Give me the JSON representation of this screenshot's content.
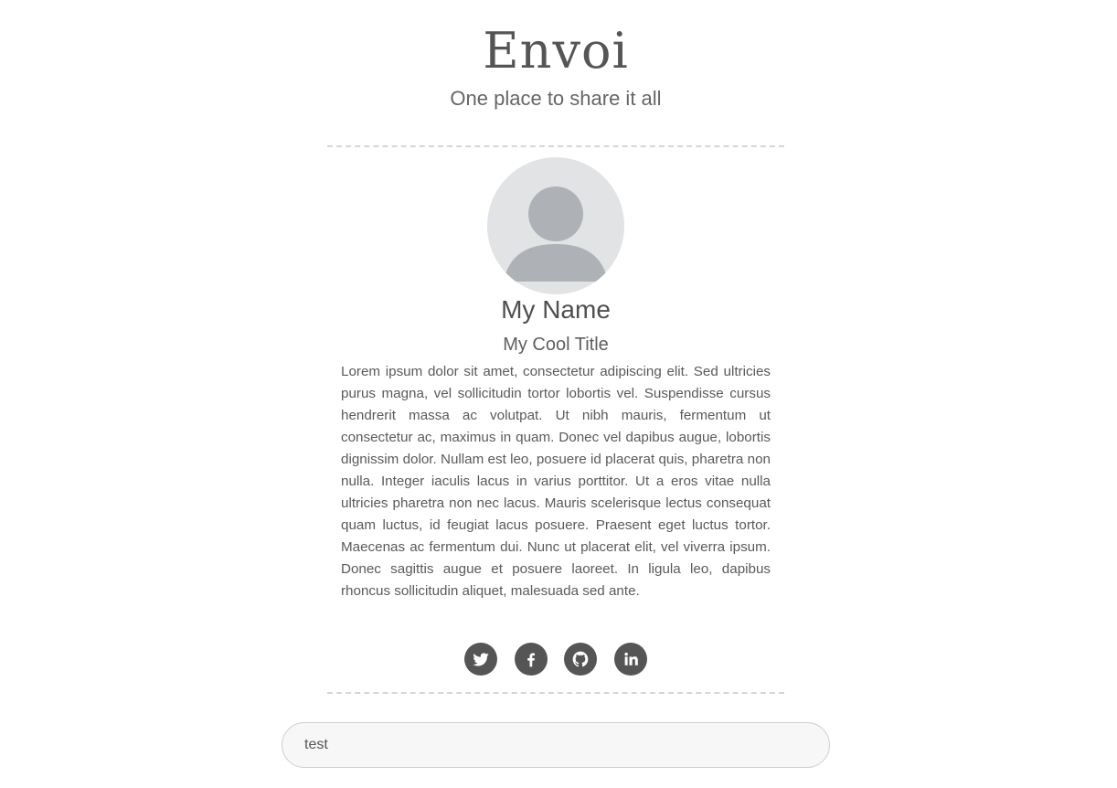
{
  "header": {
    "title": "Envoi",
    "tagline": "One place to share it all"
  },
  "profile": {
    "avatar_icon": "user-silhouette-icon",
    "name": "My Name",
    "title": "My Cool Title",
    "bio": "Lorem ipsum dolor sit amet, consectetur adipiscing elit. Sed ultricies purus magna, vel sollicitudin tortor lobortis vel. Suspendisse cursus hendrerit massa ac volutpat. Ut nibh mauris, fermentum ut consectetur ac, maximus in quam. Donec vel dapibus augue, lobortis dignissim dolor. Nullam est leo, posuere id placerat quis, pharetra non nulla. Integer iaculis lacus in varius porttitor. Ut a eros vitae nulla ultricies pharetra non nec lacus. Mauris scelerisque lectus consequat quam luctus, id feugiat lacus posuere. Praesent eget luctus tortor. Maecenas ac fermentum dui. Nunc ut placerat elit, vel viverra ipsum. Donec sagittis augue et posuere laoreet. In ligula leo, dapibus rhoncus sollicitudin aliquet, malesuada sed ante."
  },
  "social": [
    {
      "icon": "twitter-icon"
    },
    {
      "icon": "facebook-icon"
    },
    {
      "icon": "github-icon"
    },
    {
      "icon": "linkedin-icon"
    }
  ],
  "input": {
    "value": "test"
  },
  "colors": {
    "text": "#555555",
    "avatar_bg": "#e2e3e5",
    "avatar_figure": "#aeb1b5",
    "social_bg": "#555555",
    "divider": "#d6d6d6",
    "input_bg": "#f7f7f8"
  }
}
